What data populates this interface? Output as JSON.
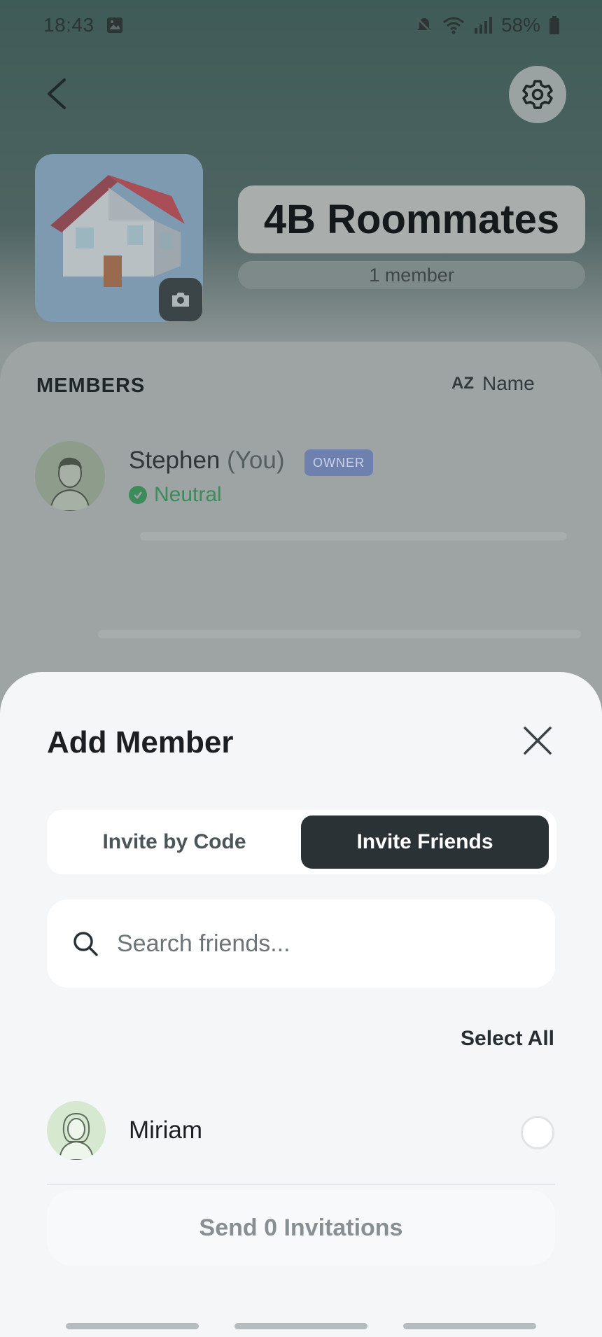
{
  "status_bar": {
    "time": "18:43",
    "battery": "58%",
    "icons": [
      "gallery-icon",
      "mute-icon",
      "wifi-icon",
      "signal-icon",
      "battery-icon"
    ]
  },
  "group": {
    "name": "4B Roommates",
    "member_count": "1 member"
  },
  "members_section": {
    "heading": "MEMBERS",
    "sort_icon": "AZ",
    "sort_label": "Name",
    "members": [
      {
        "name": "Stephen",
        "you_tag": "(You)",
        "badge": "OWNER",
        "status": "Neutral"
      }
    ]
  },
  "sheet": {
    "title": "Add Member",
    "tabs": [
      {
        "label": "Invite by Code",
        "active": false
      },
      {
        "label": "Invite Friends",
        "active": true
      }
    ],
    "search": {
      "placeholder": "Search friends...",
      "value": ""
    },
    "select_all": "Select All",
    "friends": [
      {
        "name": "Miriam",
        "selected": false
      }
    ],
    "send_button": "Send 0 Invitations"
  },
  "colors": {
    "accent_dark": "#2b3236",
    "status_green": "#3b8c5a",
    "owner_badge": "#6e80ad",
    "sheet_bg": "#f5f6f7"
  }
}
